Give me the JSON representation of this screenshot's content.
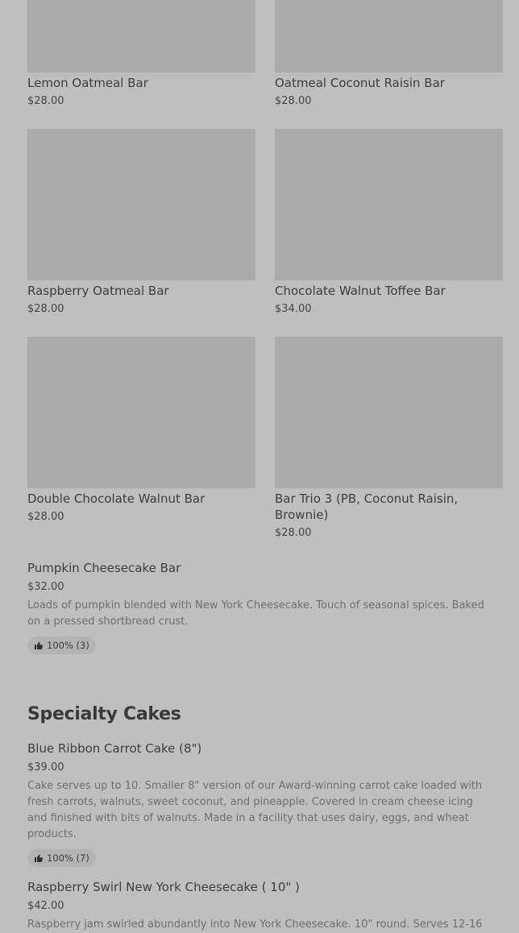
{
  "bars": [
    {
      "name": "Lemon Oatmeal Bar",
      "price": "$28.00"
    },
    {
      "name": "Oatmeal Coconut Raisin Bar",
      "price": "$28.00"
    },
    {
      "name": "Raspberry Oatmeal Bar",
      "price": "$28.00"
    },
    {
      "name": "Chocolate Walnut Toffee Bar",
      "price": "$34.00"
    },
    {
      "name": "Double Chocolate Walnut Bar",
      "price": "$28.00"
    },
    {
      "name": "Bar Trio 3 (PB, Coconut Raisin, Brownie)",
      "price": "$28.00"
    }
  ],
  "pumpkin": {
    "name": "Pumpkin Cheesecake Bar",
    "price": "$32.00",
    "description": "Loads of pumpkin blended with New York Cheesecake. Touch of seasonal spices. Baked on a pressed shortbread crust.",
    "rating": "100% (3)",
    "rating_icon": "thumbs-up-icon"
  },
  "section": {
    "title": "Specialty Cakes"
  },
  "cakes": [
    {
      "name": "Blue Ribbon Carrot Cake (8\")",
      "price": "$39.00",
      "description": "Cake serves up to 10. Smaller 8\" version of our Award-winning carrot cake loaded with fresh carrots, walnuts, sweet coconut, and pineapple. Covered in cream cheese icing and finished with bits of walnuts. Made in a facility that uses dairy, eggs, and wheat products.",
      "rating": "100% (7)",
      "rating_icon": "thumbs-up-icon"
    },
    {
      "name": "Raspberry Swirl New York Cheesecake ( 10\" )",
      "price": "$42.00",
      "description": "Raspberry jam swirled abundantly into New York Cheesecake. 10\" round. Serves 12-16"
    }
  ],
  "colors": {
    "background": "#bfbfbf",
    "image_placeholder": "#ababab",
    "badge": "#b3b3b3"
  }
}
